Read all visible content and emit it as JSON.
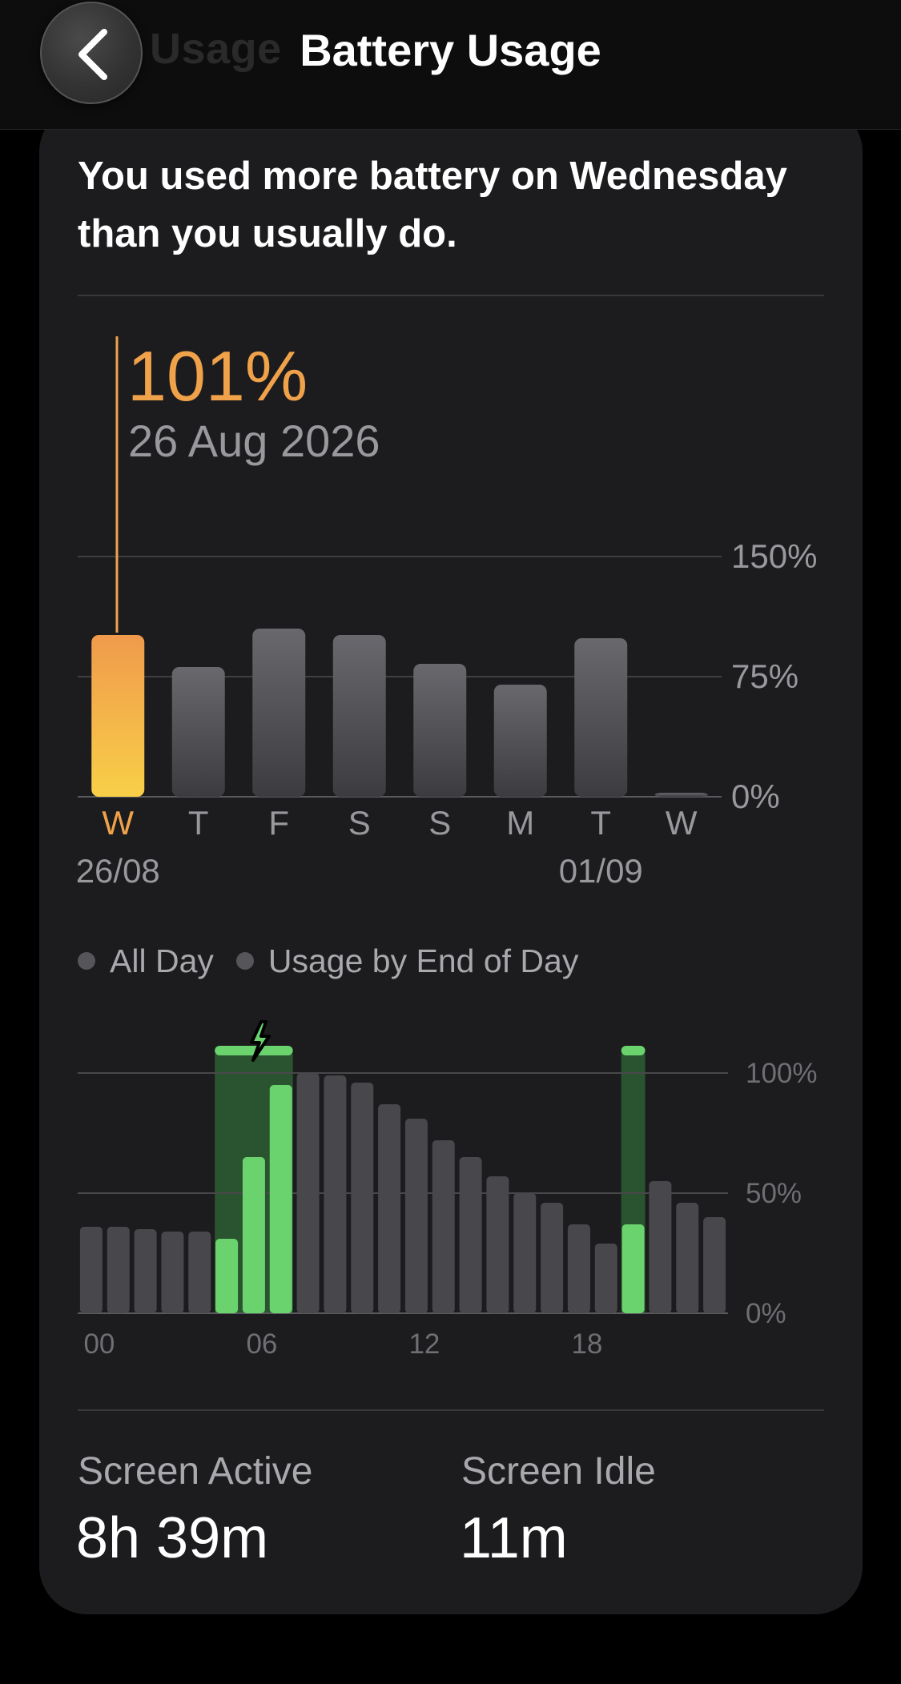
{
  "header": {
    "title": "Battery Usage",
    "ghost_text": "ily Usage",
    "back_icon": "chevron-left-icon"
  },
  "summary": {
    "headline": "You used more battery on Wednesday than you usually do."
  },
  "selection": {
    "value": "101%",
    "date": "26 Aug 2026"
  },
  "colors": {
    "accent": "#f0a24a",
    "bar_gray": "#636366",
    "green": "#6ad36e",
    "green_dim": "#2d5d32",
    "card": "#1c1c1e"
  },
  "legend": {
    "all_day": "All Day",
    "usage_end_of_day": "Usage by End of Day"
  },
  "chart_data": [
    {
      "type": "bar",
      "categories": [
        "W",
        "T",
        "F",
        "S",
        "S",
        "M",
        "T",
        "W"
      ],
      "date_labels": [
        "26/08",
        "",
        "",
        "",
        "",
        "",
        "01/09",
        ""
      ],
      "values": [
        101,
        81,
        105,
        101,
        83,
        70,
        99,
        2
      ],
      "highlighted_index": 0,
      "y_ticks": [
        "150%",
        "75%",
        "0%"
      ],
      "ylim": [
        0,
        150
      ]
    },
    {
      "type": "bar",
      "x_ticks": [
        "00",
        "06",
        "12",
        "18"
      ],
      "values": [
        36,
        36,
        35,
        34,
        34,
        31,
        65,
        95,
        100,
        99,
        96,
        87,
        81,
        72,
        65,
        57,
        50,
        46,
        37,
        29,
        37,
        55,
        46,
        40
      ],
      "charging": [
        false,
        false,
        false,
        false,
        false,
        true,
        true,
        true,
        false,
        false,
        false,
        false,
        false,
        false,
        false,
        false,
        false,
        false,
        false,
        false,
        true,
        false,
        false,
        false
      ],
      "charging_bands": [
        [
          5,
          7
        ],
        [
          20,
          20
        ]
      ],
      "y_ticks": [
        "100%",
        "50%",
        "0%"
      ],
      "ylim": [
        0,
        100
      ]
    }
  ],
  "stats": {
    "screen_active_label": "Screen Active",
    "screen_active_value": "8h 39m",
    "screen_idle_label": "Screen Idle",
    "screen_idle_value": "11m"
  }
}
